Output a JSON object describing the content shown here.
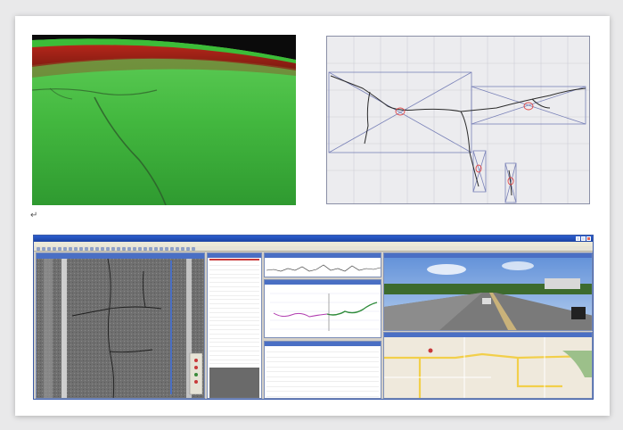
{
  "return_glyph": "↵",
  "app": {
    "title": "",
    "menu": [
      "",
      "",
      "",
      "",
      "",
      ""
    ],
    "list_rows": [
      "",
      "",
      "",
      "",
      "",
      "",
      "",
      "",
      "",
      "",
      "",
      "",
      "",
      "",
      "",
      "",
      "",
      "",
      "",
      "",
      "",
      "",
      "",
      ""
    ],
    "table_rows": [
      "",
      "",
      "",
      "",
      "",
      "",
      "",
      "",
      "",
      ""
    ]
  },
  "colors": {
    "surface_green": "#3fbf3a",
    "surface_red": "#9a1d12",
    "crack_map_bg": "#ececef",
    "crack_marker": "#e04848",
    "window_blue": "#2b5dcd",
    "profile_green": "#2e8b3a",
    "profile_magenta": "#b03bb0"
  }
}
